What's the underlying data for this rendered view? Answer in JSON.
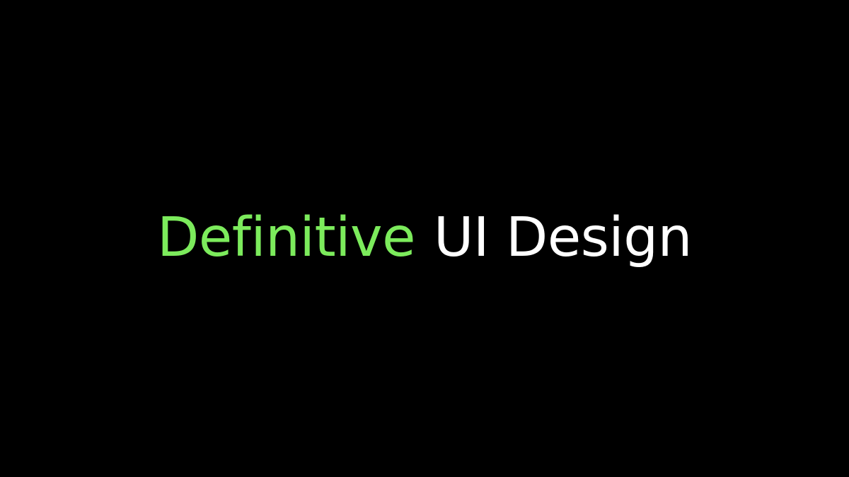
{
  "headline": {
    "accent_text": "Definitive",
    "main_text": "UI Design"
  },
  "colors": {
    "background": "#000000",
    "accent": "#7CEB5C",
    "main": "#FFFFFF"
  }
}
